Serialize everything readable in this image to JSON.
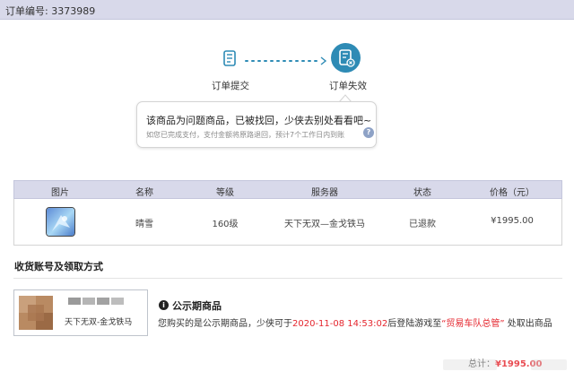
{
  "order": {
    "header": "订单编号: 3373989"
  },
  "progress": {
    "steps": [
      {
        "label": "订单提交",
        "icon": "document-icon"
      },
      {
        "label": "订单失效",
        "icon": "document-x-icon",
        "active": true
      }
    ]
  },
  "notice": {
    "title": "该商品为问题商品，已被找回，少侠去别处看看吧~",
    "subtitle": "如您已完成支付，支付金额将原路退回，预计7个工作日内到账",
    "help_icon": "?"
  },
  "table": {
    "headers": [
      "图片",
      "名称",
      "等级",
      "服务器",
      "状态",
      "价格（元）"
    ],
    "row": {
      "image_icon": "item-thumbnail",
      "name": "晴雪",
      "level": "160级",
      "server": "天下无双—金戈铁马",
      "status": "已退款",
      "price": "¥1995.00"
    }
  },
  "delivery": {
    "section_title": "收货账号及领取方式",
    "account_desc": "天下无双-金戈铁马",
    "public_title": "公示期商品",
    "public_desc_pre": "您购买的是公示期商品，少侠可于",
    "public_desc_time": "2020-11-08 14:53:02",
    "public_desc_mid": "后登陆游戏至",
    "public_desc_npc": "“贸易车队总管”",
    "public_desc_post": " 处取出商品",
    "info_icon": "i"
  },
  "total": {
    "label": "总计：",
    "amount": "¥1995.00"
  },
  "colors": {
    "accent": "#2e8bb5",
    "header_bg": "#d8d9ea",
    "price_red": "#e5262e"
  }
}
